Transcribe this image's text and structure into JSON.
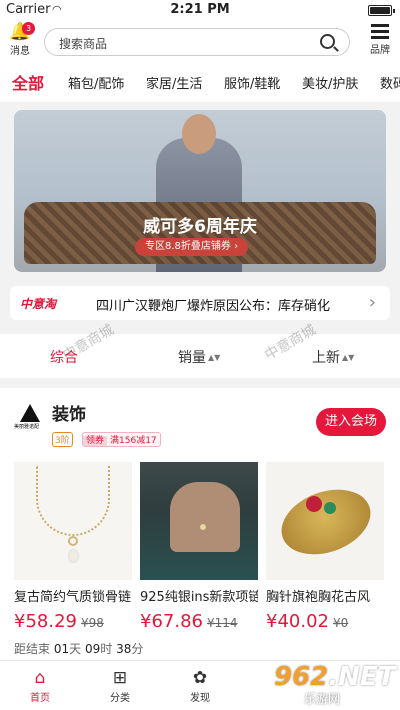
{
  "statusbar": {
    "carrier": "Carrier",
    "wifi": "wifi-icon",
    "time": "2:21 PM",
    "battery_level": 1.0
  },
  "header": {
    "messages": {
      "label": "消息",
      "badge": "3"
    },
    "search": {
      "placeholder": "搜索商品"
    },
    "brand": {
      "label": "品牌"
    }
  },
  "categories": [
    "全部",
    "箱包/配饰",
    "家居/生活",
    "服饰/鞋靴",
    "美妆/护肤",
    "数码"
  ],
  "banner": {
    "title": "威可多6周年庆",
    "subtitle": "专区8.8折叠店铺券 ›"
  },
  "ticker": {
    "tag": "中意淘",
    "text": "四川广汉鞭炮厂爆炸原因公布：库存硝化",
    "arrow": "›"
  },
  "sort": {
    "items": [
      "综合",
      "销量",
      "上新"
    ],
    "caret": "▲▼"
  },
  "watermark": "中意商城",
  "section": {
    "logo_caption": "美丽雅诺配",
    "title": "装饰",
    "level": "3阶",
    "coupon_key": "领券",
    "coupon_value": "满156减17",
    "enter": "进入会场",
    "products": [
      {
        "name": "复古简约气质锁骨链",
        "price": "¥58.29",
        "old_price": "¥98"
      },
      {
        "name": "925纯银ins新款项链",
        "price": "¥67.86",
        "old_price": "¥114"
      },
      {
        "name": "胸针旗袍胸花古风",
        "price": "¥40.02",
        "old_price": "¥0"
      }
    ],
    "countdown": {
      "prefix": "距结束",
      "d": "01",
      "d_unit": "天",
      "h": "09",
      "h_unit": "时",
      "m": "38",
      "m_unit": "分"
    }
  },
  "tabbar": {
    "items": [
      {
        "label": "首页",
        "icon": "home-icon"
      },
      {
        "label": "分类",
        "icon": "grid-icon"
      },
      {
        "label": "发现",
        "icon": "flower-icon"
      }
    ]
  },
  "site_watermark": {
    "num": "962",
    "suffix": ".NET",
    "sub": "乐游网"
  },
  "colors": {
    "accent": "#e5173b"
  }
}
